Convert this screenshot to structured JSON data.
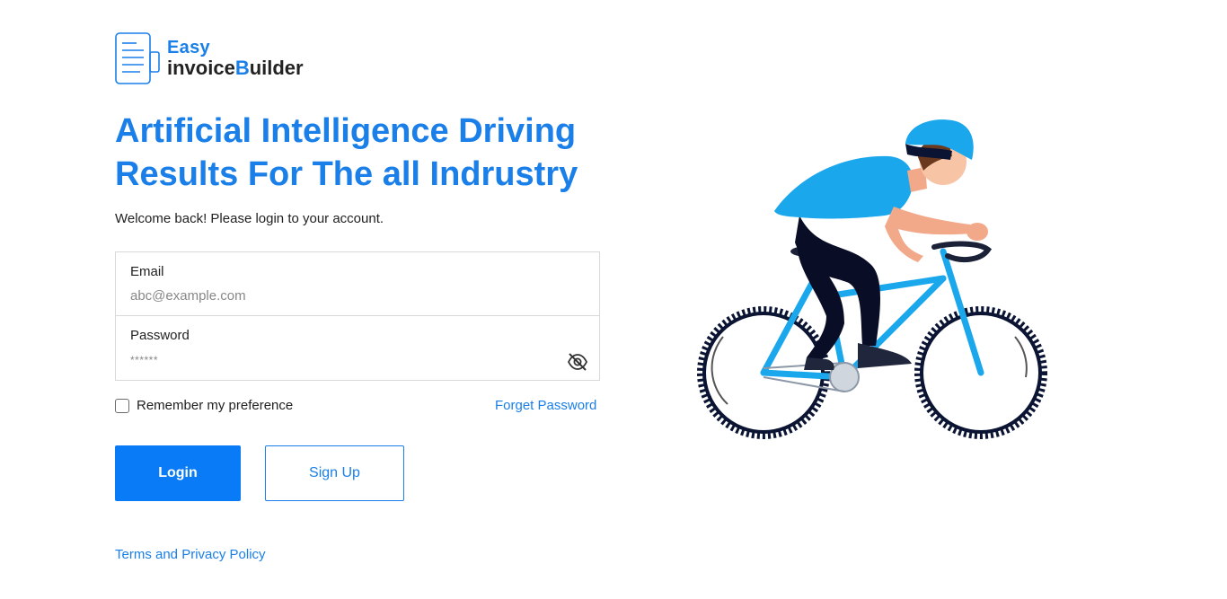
{
  "logo": {
    "line1": "Easy",
    "line2_prefix": "invoice",
    "line2_highlight": "B",
    "line2_suffix": "uilder"
  },
  "headline": "Artificial Intelligence Driving Results For The all Indrustry",
  "welcome_text": "Welcome back! Please login to your account.",
  "email": {
    "label": "Email",
    "placeholder": "abc@example.com",
    "value": ""
  },
  "password": {
    "label": "Password",
    "masked_value": "******",
    "toggle_icon": "eye-slash-icon"
  },
  "remember": {
    "label": "Remember my preference",
    "checked": false
  },
  "forget_password_label": "Forget Password",
  "login_label": "Login",
  "signup_label": "Sign Up",
  "terms_label": "Terms and Privacy Policy",
  "illustration": {
    "icon": "cyclist-illustration"
  },
  "colors": {
    "accent": "#1a7fe8",
    "button_primary": "#0a7bf7",
    "bike_blue": "#1aa7ec",
    "text": "#222222",
    "border": "#d9d9d9"
  }
}
